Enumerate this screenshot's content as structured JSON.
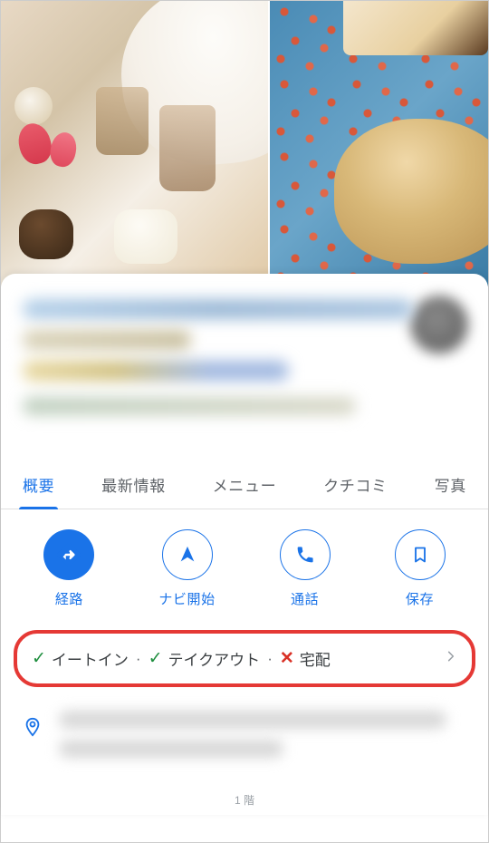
{
  "tabs": [
    {
      "label": "概要",
      "active": true
    },
    {
      "label": "最新情報",
      "active": false
    },
    {
      "label": "メニュー",
      "active": false
    },
    {
      "label": "クチコミ",
      "active": false
    },
    {
      "label": "写真",
      "active": false
    }
  ],
  "actions": {
    "directions": "経路",
    "navigate": "ナビ開始",
    "call": "通話",
    "save": "保存"
  },
  "service_options": {
    "eat_in": "イートイン",
    "takeout": "テイクアウト",
    "delivery": "宅配"
  },
  "footer": "1 階"
}
